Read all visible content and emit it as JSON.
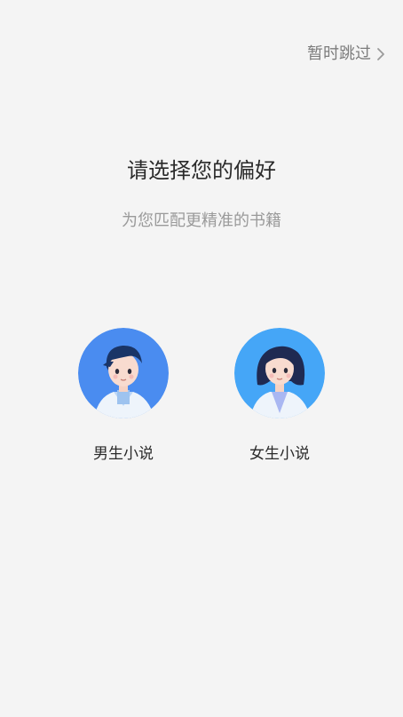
{
  "header": {
    "skip_label": "暂时跳过"
  },
  "main": {
    "title": "请选择您的偏好",
    "subtitle": "为您匹配更精准的书籍"
  },
  "options": [
    {
      "label": "男生小说",
      "icon": "male-avatar-icon",
      "color": "#4a8cf0"
    },
    {
      "label": "女生小说",
      "icon": "female-avatar-icon",
      "color": "#45a6f7"
    }
  ]
}
